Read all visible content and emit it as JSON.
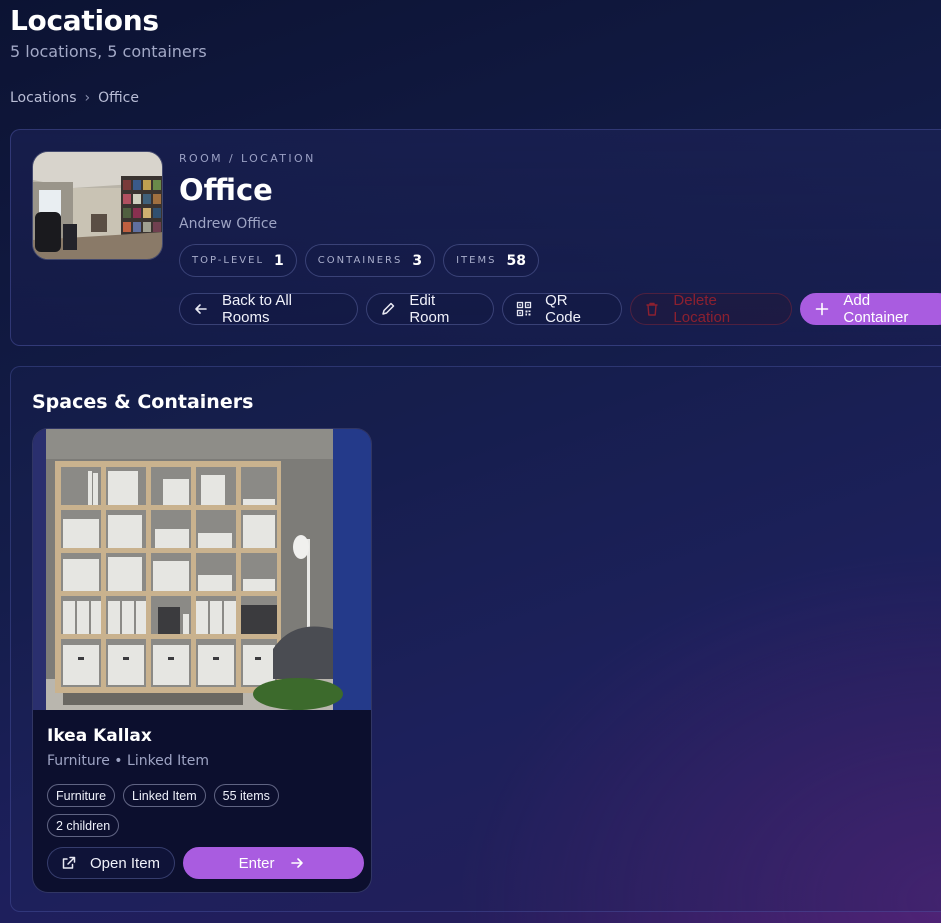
{
  "page": {
    "title": "Locations",
    "subtitle": "5 locations, 5 containers"
  },
  "breadcrumb": {
    "root": "Locations",
    "separator": "›",
    "current": "Office"
  },
  "room": {
    "kicker": "ROOM / LOCATION",
    "name": "Office",
    "description": "Andrew Office",
    "stats": [
      {
        "label": "TOP-LEVEL",
        "value": "1"
      },
      {
        "label": "CONTAINERS",
        "value": "3"
      },
      {
        "label": "ITEMS",
        "value": "58"
      }
    ],
    "actions": {
      "back": "Back to All Rooms",
      "edit": "Edit Room",
      "qr": "QR Code",
      "delete": "Delete Location",
      "add": "Add Container"
    }
  },
  "spaces": {
    "title": "Spaces & Containers",
    "containers": [
      {
        "name": "Ikea Kallax",
        "subtitle": "Furniture • Linked Item",
        "chips": [
          "Furniture",
          "Linked Item",
          "55 items",
          "2 children"
        ],
        "open_label": "Open Item",
        "enter_label": "Enter"
      }
    ]
  },
  "colors": {
    "accent": "#a95ce0",
    "danger": "#8c2030",
    "background": "#141d4a"
  },
  "icons": [
    "arrow-left-icon",
    "pencil-icon",
    "qr-code-icon",
    "trash-icon",
    "plus-icon",
    "external-link-icon",
    "arrow-right-icon"
  ]
}
